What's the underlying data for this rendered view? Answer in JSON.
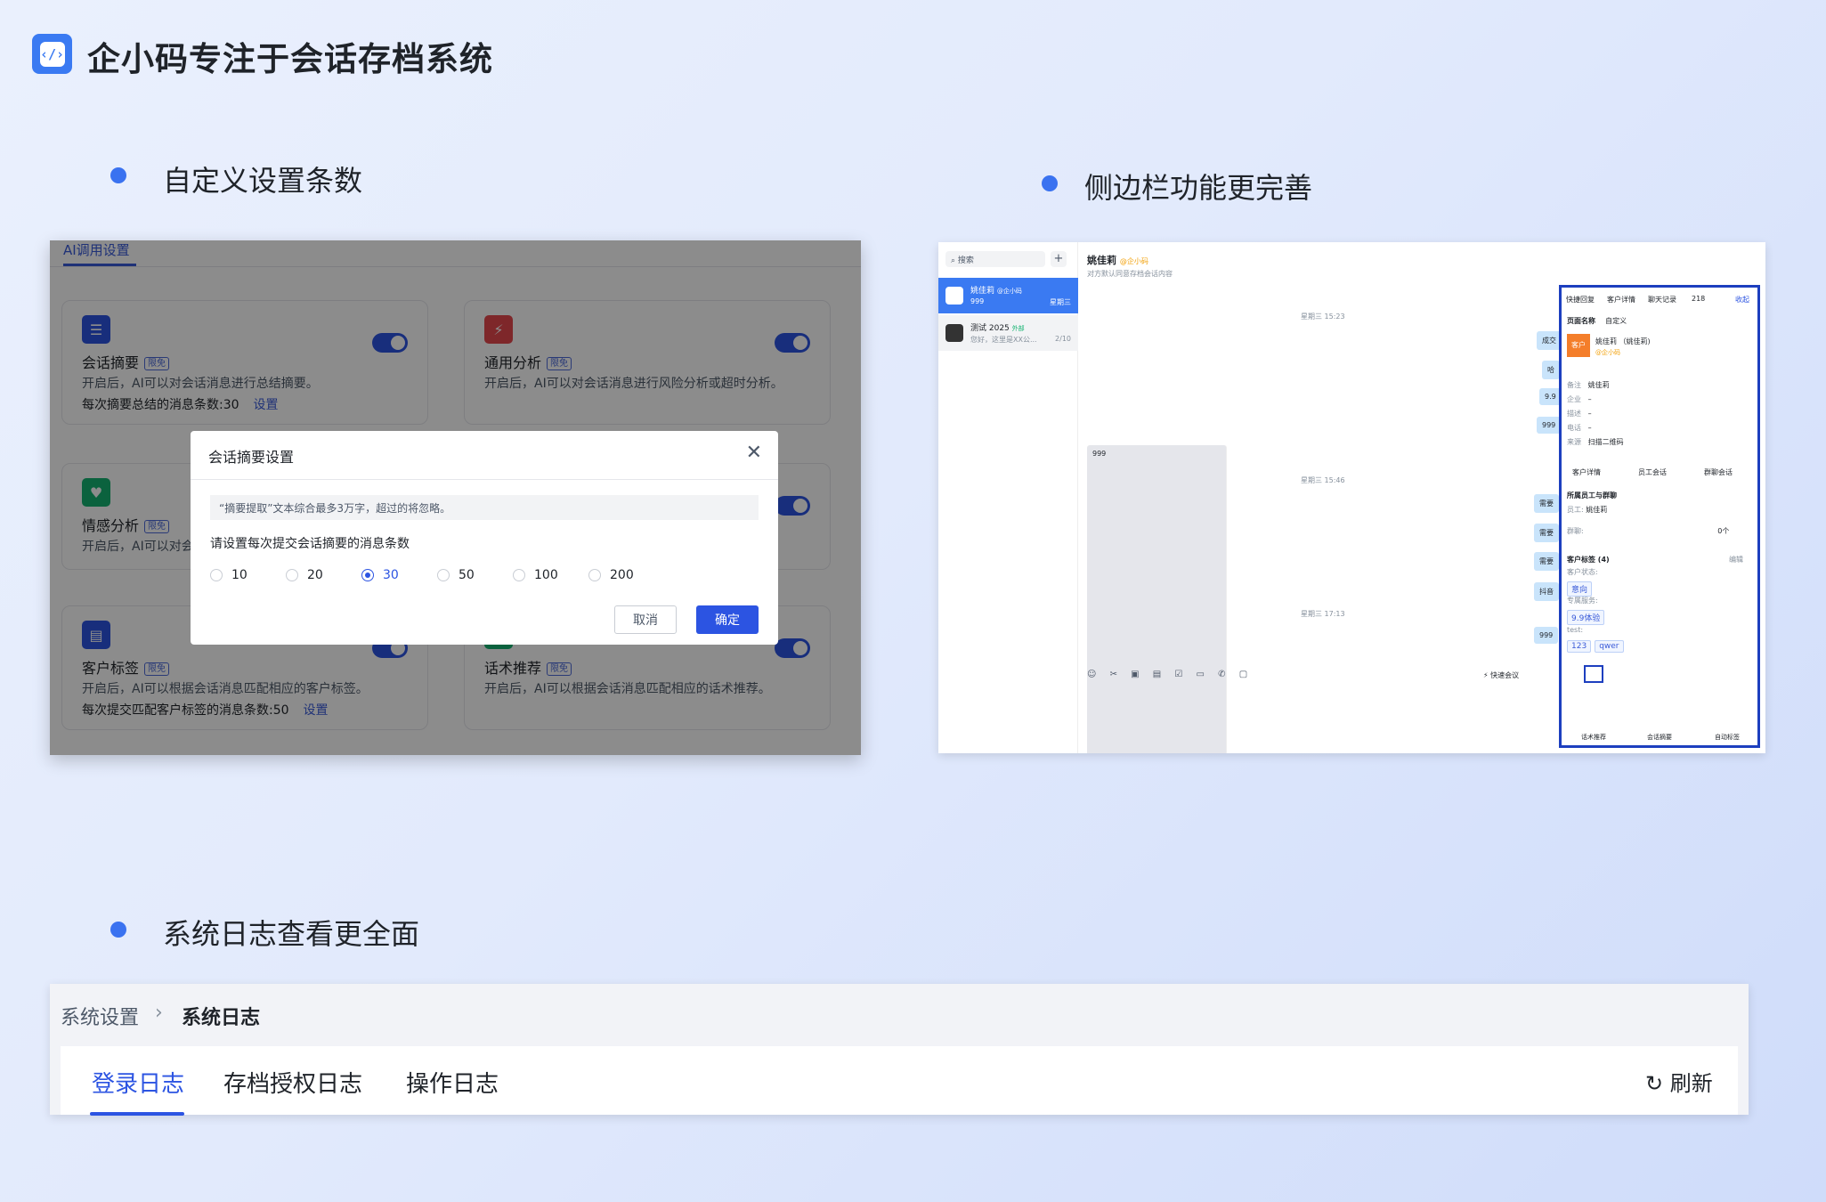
{
  "header": {
    "title": "企小码专注于会话存档系统",
    "logo_icon": "code-bracket-icon"
  },
  "sections": [
    {
      "title": "自定义设置条数"
    },
    {
      "title": "侧边栏功能更完善"
    },
    {
      "title": "系统日志查看更全面"
    }
  ],
  "panel1": {
    "tab_label": "AI调用设置",
    "cards": [
      {
        "title": "会话摘要",
        "tag": "限免",
        "desc": "开启后，AI可以对会话消息进行总结摘要。",
        "count": "每次摘要总结的消息条数:30",
        "link": "设置",
        "icon": "summary-icon",
        "color": "#2c54e2"
      },
      {
        "title": "通用分析",
        "tag": "限免",
        "desc": "开启后，AI可以对会话消息进行风险分析或超时分析。",
        "icon": "lightning-icon",
        "color": "#e5484d"
      },
      {
        "title": "情感分析",
        "tag": "限免",
        "desc": "开启后，AI可以对会",
        "icon": "heart-icon",
        "color": "#15b371"
      },
      {
        "title": "客户标签",
        "tag": "限免",
        "desc": "开启后，AI可以根据会话消息匹配相应的客户标签。",
        "count": "每次提交匹配客户标签的消息条数:50",
        "link": "设置",
        "icon": "bookmark-icon",
        "color": "#2c54e2"
      },
      {
        "title": "话术推荐",
        "tag": "限免",
        "desc": "开启后，AI可以根据会话消息匹配相应的话术推荐。",
        "icon": "script-icon",
        "color": "#15b371"
      }
    ],
    "modal": {
      "title": "会话摘要设置",
      "note": "“摘要提取”文本综合最多3万字，超过的将忽略。",
      "prompt": "请设置每次提交会话摘要的消息条数",
      "options": [
        "10",
        "20",
        "30",
        "50",
        "100",
        "200"
      ],
      "selected": "30",
      "cancel": "取消",
      "ok": "确定"
    }
  },
  "panel2": {
    "search_placeholder": "搜索",
    "conversations": [
      {
        "name": "姚佳莉",
        "org": "@企小码",
        "snippet": "999",
        "time": "星期三"
      },
      {
        "name": "测试 2025",
        "badge": "外部",
        "snippet": "您好，这里是XX公...",
        "time": "2/10"
      }
    ],
    "chat_name": "姚佳莉",
    "chat_org": "@企小码",
    "chat_sub": "对方默认同意存档会话内容",
    "timestamps": [
      "星期三 15:23",
      "星期三 15:46",
      "星期三 17:13"
    ],
    "messages": [
      "成交",
      "哈",
      "9.9",
      "999",
      "999",
      "需要",
      "需要",
      "需要",
      "抖音",
      "999"
    ],
    "quick_meeting": "快速会议",
    "side_tabs": [
      "快捷回复",
      "客户详情",
      "聊天记录",
      "218",
      "收起"
    ],
    "page_name_label": "页面名称",
    "custom_label": "自定义",
    "customer_badge": "客户",
    "customer_name": "姚佳莉 （姚佳莉)",
    "customer_org": "@企小码",
    "fields": [
      {
        "label": "备注",
        "value": "姚佳莉"
      },
      {
        "label": "企业",
        "value": "–"
      },
      {
        "label": "描述",
        "value": "–"
      },
      {
        "label": "电话",
        "value": "–"
      },
      {
        "label": "来源",
        "value": "扫描二维码"
      }
    ],
    "detail_tabs": [
      "客户详情",
      "员工会话",
      "群聊会话"
    ],
    "staff_group_title": "所属员工与群聊",
    "staff_label": "员工:",
    "staff_value": "姚佳莉",
    "group_label": "群聊:",
    "group_value": "0个",
    "tags_title": "客户标签 (4)",
    "edit_label": "编辑",
    "status_label": "客户状态:",
    "status_tag": "意向",
    "service_label": "专属服务:",
    "service_tag": "9.9体验",
    "test_label": "test:",
    "test_tags": [
      "123",
      "qwer"
    ],
    "bottom_actions": [
      "话术推荐",
      "会话摘要",
      "自动标签"
    ]
  },
  "panel3": {
    "breadcrumb_root": "系统设置",
    "breadcrumb_current": "系统日志",
    "tabs": [
      "登录日志",
      "存档授权日志",
      "操作日志"
    ],
    "active_tab": "登录日志",
    "refresh": "刷新"
  }
}
